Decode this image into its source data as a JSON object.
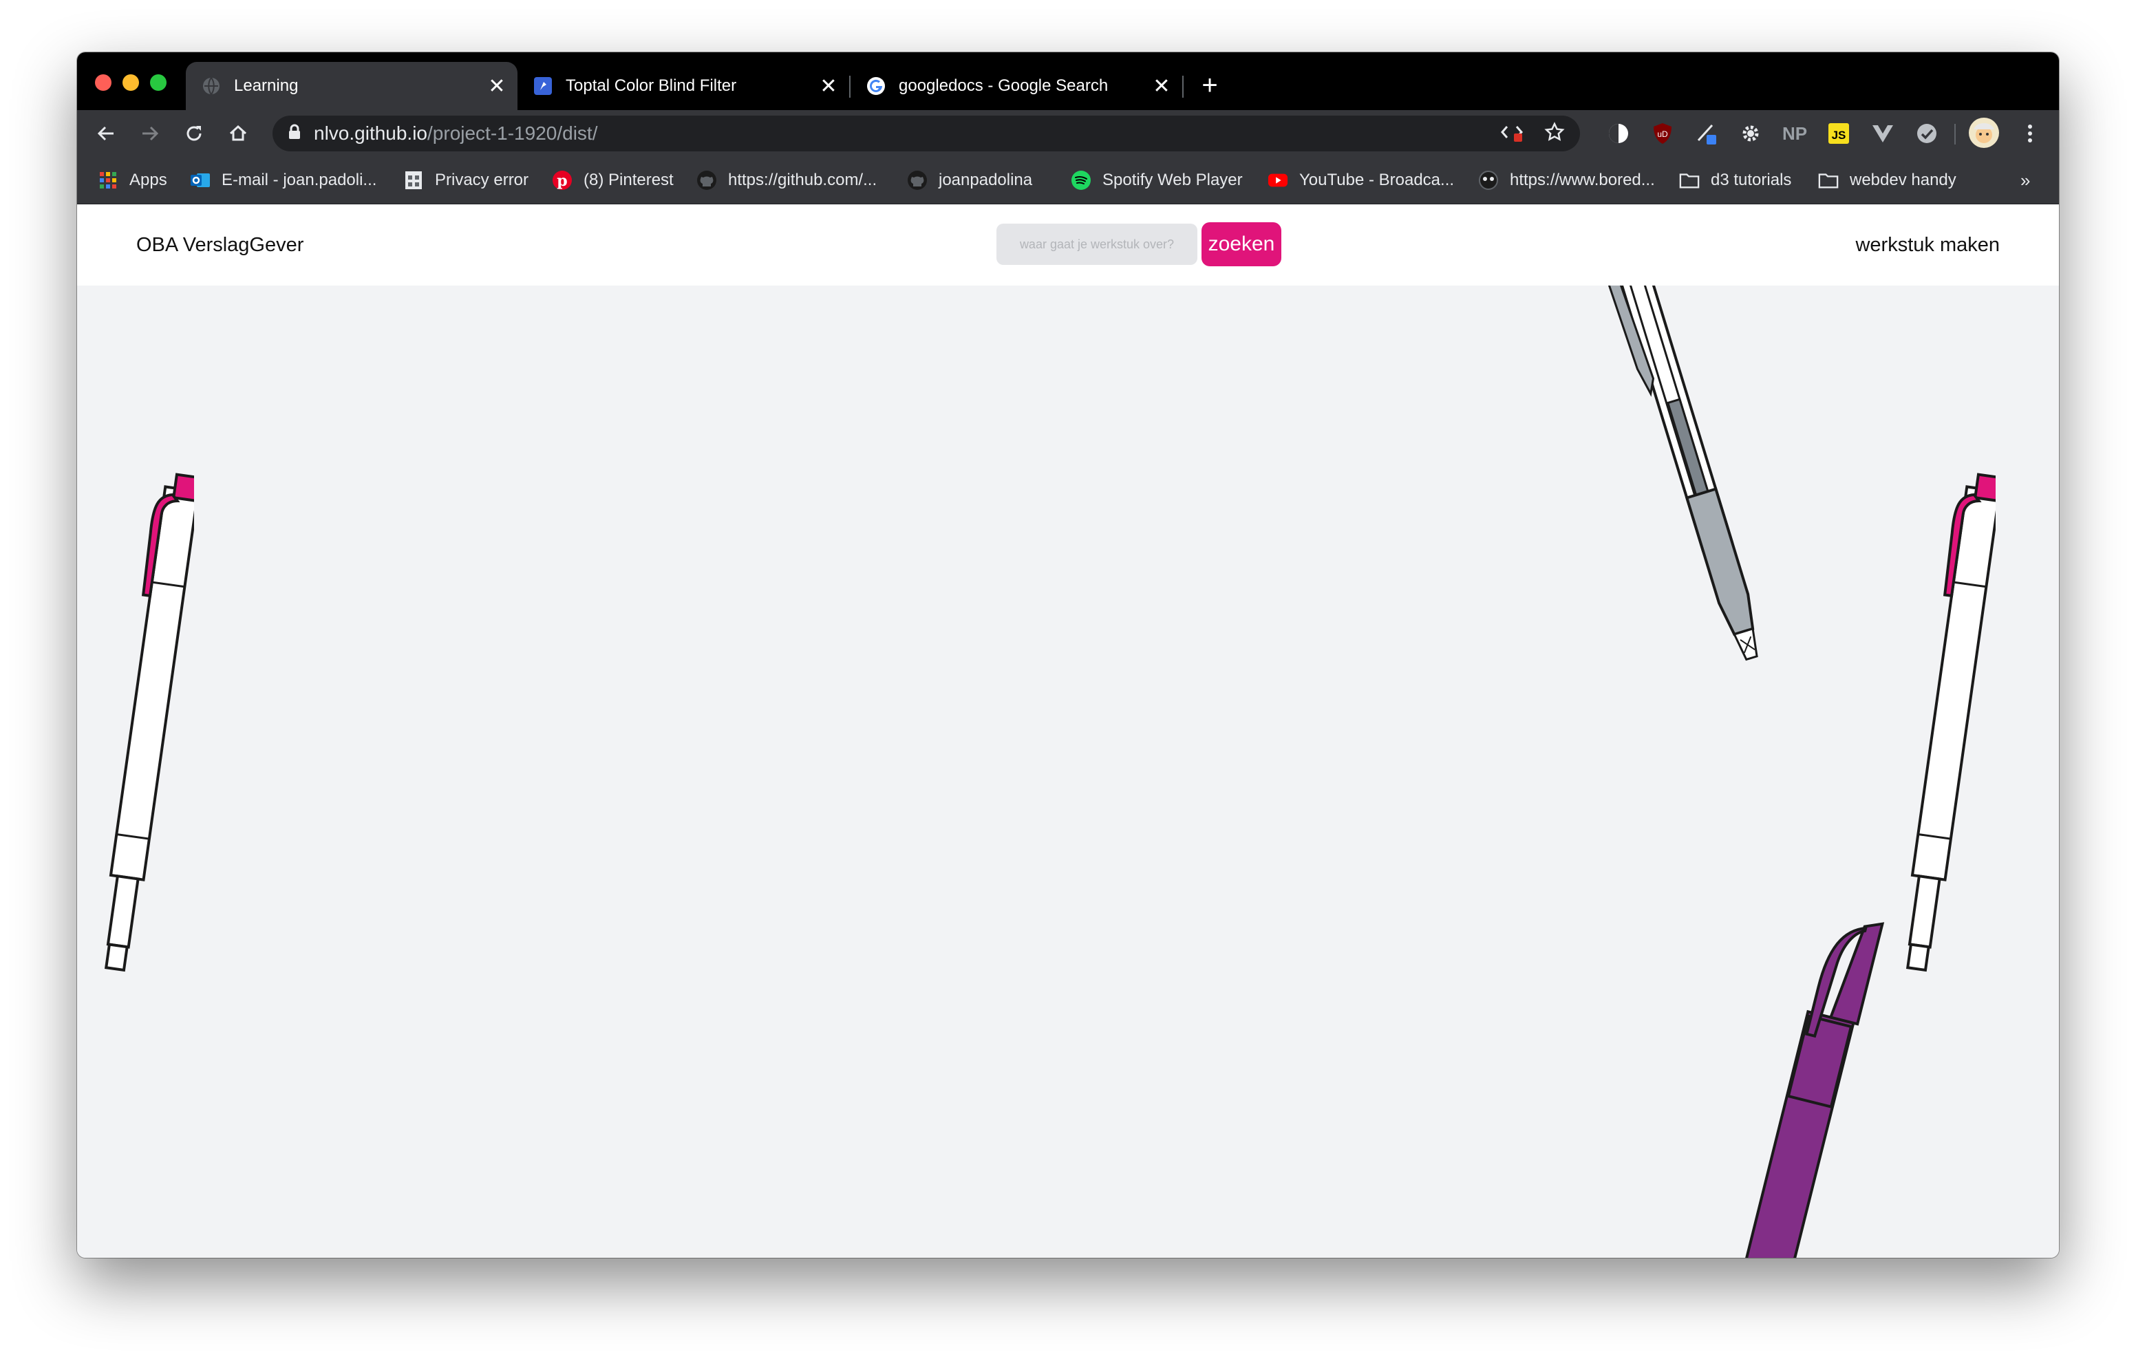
{
  "browser": {
    "tabs": [
      {
        "title": "Learning",
        "icon": "globe-icon",
        "active": true
      },
      {
        "title": "Toptal Color Blind Filter",
        "icon": "toptal-icon",
        "active": false
      },
      {
        "title": "googledocs - Google Search",
        "icon": "google-icon",
        "active": false
      }
    ],
    "new_tab": "+",
    "url": {
      "host": "nlvo.github.io",
      "path": "/project-1-1920/dist/"
    },
    "bookmarks": [
      {
        "label": "Apps",
        "icon": "apps-grid-icon"
      },
      {
        "label": "E-mail - joan.padoli...",
        "icon": "outlook-icon"
      },
      {
        "label": "Privacy error",
        "icon": "page-icon"
      },
      {
        "label": "(8) Pinterest",
        "icon": "pinterest-icon"
      },
      {
        "label": "https://github.com/...",
        "icon": "github-icon"
      },
      {
        "label": "joanpadolina",
        "icon": "github-icon"
      },
      {
        "label": "Spotify Web Player",
        "icon": "spotify-icon"
      },
      {
        "label": "YouTube - Broadca...",
        "icon": "youtube-icon"
      },
      {
        "label": "https://www.bored...",
        "icon": "panda-icon"
      },
      {
        "label": "d3 tutorials",
        "icon": "folder-icon"
      },
      {
        "label": "webdev handy",
        "icon": "folder-icon"
      }
    ],
    "extensions": {
      "np_label": "NP",
      "js_label": "JS",
      "ub_label": "uD"
    },
    "more_bookmarks": "»"
  },
  "site": {
    "brand": "OBA VerslagGever",
    "search_placeholder": "waar gaat je werkstuk over?",
    "search_button": "zoeken",
    "cta": "werkstuk maken"
  },
  "colors": {
    "accent": "#e0147a",
    "pen_purple": "#822e87",
    "pen_grey": "#a6adb3",
    "page_bg": "#f2f3f5"
  }
}
